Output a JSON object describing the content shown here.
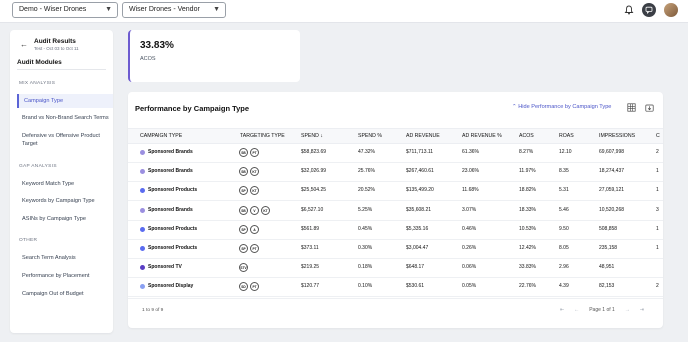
{
  "topbar": {
    "account_select": "Demo - Wiser Drones",
    "vendor_select": "Wiser Drones - Vendor"
  },
  "sidebar": {
    "title": "Audit Results",
    "subtitle": "Test - Oct 03 to Oct 11",
    "modules_heading": "Audit Modules",
    "sections": [
      {
        "label": "MIX ANALYSIS",
        "items": [
          "Campaign Type",
          "Brand vs Non-Brand Search Terms",
          "Defensive vs Offensive Product Target"
        ]
      },
      {
        "label": "GAP ANALYSIS",
        "items": [
          "Keyword Match Type",
          "Keywords by Campaign Type",
          "ASINs by Campaign Type"
        ]
      },
      {
        "label": "OTHER",
        "items": [
          "Search Term Analysis",
          "Performance by Placement",
          "Campaign Out of Budget"
        ]
      }
    ],
    "active_item": "Campaign Type"
  },
  "metric": {
    "value": "33.83%",
    "label": "ACOS"
  },
  "panel": {
    "title": "Performance by Campaign Type",
    "hide_link": "Hide Performance by Campaign Type",
    "columns": [
      "CAMPAIGN TYPE",
      "TARGETING TYPE",
      "SPEND",
      "SPEND %",
      "AD REVENUE",
      "AD REVENUE %",
      "ACOS",
      "ROAS",
      "IMPRESSIONS",
      "C"
    ],
    "rows": [
      {
        "dot": "#9b8fe0",
        "type": "Sponsored Brands",
        "targeting": [
          "SB",
          "PT"
        ],
        "spend": "$58,823.69",
        "spend_pct": "47.32%",
        "revenue": "$711,713.11",
        "revenue_pct": "61.36%",
        "acos": "8.27%",
        "roas": "12.10",
        "impressions": "69,607,998",
        "extra": "2"
      },
      {
        "dot": "#9b8fe0",
        "type": "Sponsored Brands",
        "targeting": [
          "SB",
          "KT"
        ],
        "spend": "$32,026.99",
        "spend_pct": "25.76%",
        "revenue": "$267,460.61",
        "revenue_pct": "23.06%",
        "acos": "11.97%",
        "roas": "8.35",
        "impressions": "18,274,437",
        "extra": "1"
      },
      {
        "dot": "#5b6cf0",
        "type": "Sponsored Products",
        "targeting": [
          "SP",
          "KT"
        ],
        "spend": "$25,504.25",
        "spend_pct": "20.52%",
        "revenue": "$135,499.20",
        "revenue_pct": "11.68%",
        "acos": "18.82%",
        "roas": "5.31",
        "impressions": "27,059,121",
        "extra": "1"
      },
      {
        "dot": "#9b8fe0",
        "type": "Sponsored Brands",
        "targeting": [
          "SB",
          "V",
          "KT"
        ],
        "spend": "$6,527.10",
        "spend_pct": "5.25%",
        "revenue": "$35,608.21",
        "revenue_pct": "3.07%",
        "acos": "18.33%",
        "roas": "5.46",
        "impressions": "10,520,268",
        "extra": "3"
      },
      {
        "dot": "#5b6cf0",
        "type": "Sponsored Products",
        "targeting": [
          "SP",
          "A"
        ],
        "spend": "$561.89",
        "spend_pct": "0.45%",
        "revenue": "$5,335.16",
        "revenue_pct": "0.46%",
        "acos": "10.53%",
        "roas": "9.50",
        "impressions": "508,858",
        "extra": "1"
      },
      {
        "dot": "#5b6cf0",
        "type": "Sponsored Products",
        "targeting": [
          "SP",
          "PT"
        ],
        "spend": "$373.11",
        "spend_pct": "0.30%",
        "revenue": "$3,004.47",
        "revenue_pct": "0.26%",
        "acos": "12.42%",
        "roas": "8.05",
        "impressions": "235,158",
        "extra": "1"
      },
      {
        "dot": "#5a3fc4",
        "type": "Sponsored TV",
        "targeting": [
          "STV"
        ],
        "spend": "$219.25",
        "spend_pct": "0.18%",
        "revenue": "$648.17",
        "revenue_pct": "0.06%",
        "acos": "33.83%",
        "roas": "2.96",
        "impressions": "48,951",
        "extra": ""
      },
      {
        "dot": "#8aa0f2",
        "type": "Sponsored Display",
        "targeting": [
          "SD",
          "PT"
        ],
        "spend": "$120.77",
        "spend_pct": "0.10%",
        "revenue": "$530.61",
        "revenue_pct": "0.05%",
        "acos": "22.76%",
        "roas": "4.39",
        "impressions": "82,153",
        "extra": "2"
      }
    ],
    "footer_count": "1 to 9 of 9",
    "pager_label": "Page 1 of 1"
  }
}
